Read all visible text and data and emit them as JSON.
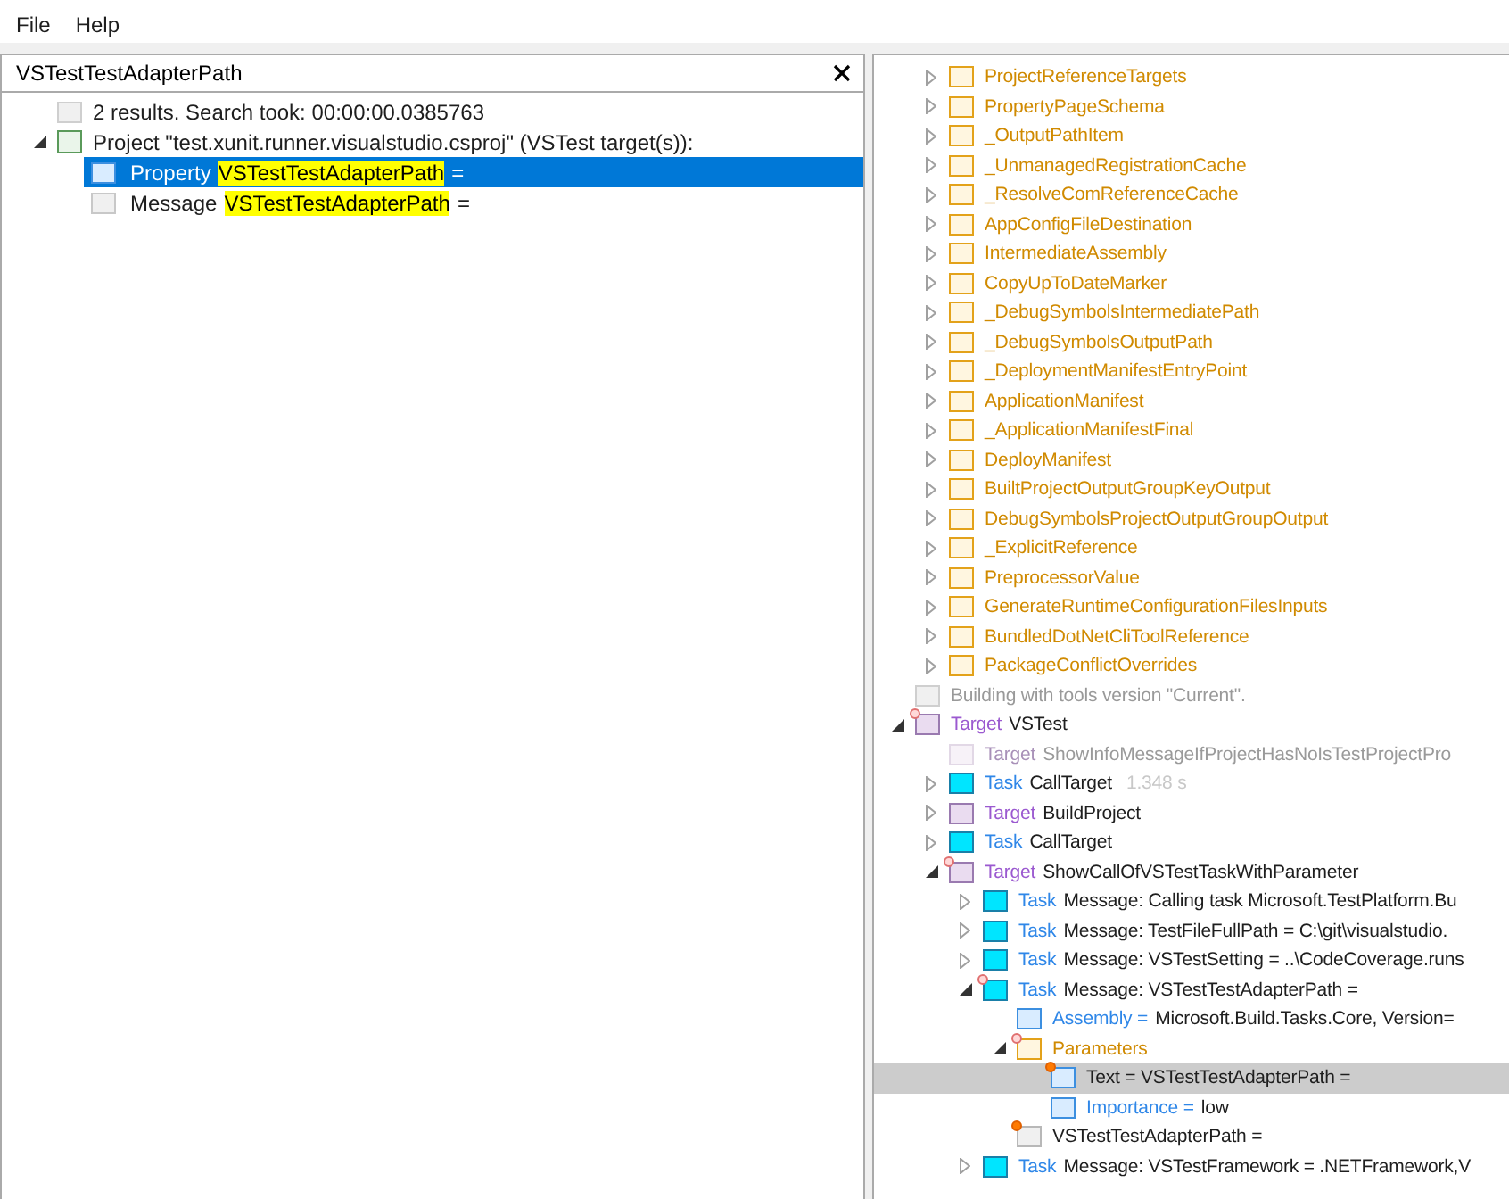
{
  "menu": [
    {
      "label": "File"
    },
    {
      "label": "Help"
    }
  ],
  "search": {
    "value": "VSTestTestAdapterPath"
  },
  "results": {
    "summary": "2 results. Search took: 00:00:00.0385763",
    "project": {
      "label": "Project \"test.xunit.runner.visualstudio.csproj\" (VSTest target(s)):",
      "expanded": true,
      "matches": [
        {
          "prefix": "Property",
          "match": "VSTestTestAdapterPath",
          "suffix": "=",
          "kind": "property",
          "selected": true
        },
        {
          "prefix": "Message",
          "match": "VSTestTestAdapterPath",
          "suffix": "=",
          "kind": "message",
          "selected": false
        }
      ]
    }
  },
  "tree": {
    "continued_items": [
      {
        "kind": "folder",
        "text": "ProjectReferenceTargets",
        "expanded": false,
        "selected": false
      },
      {
        "kind": "folder",
        "text": "PropertyPageSchema",
        "expanded": false,
        "selected": false
      },
      {
        "kind": "folder",
        "text": "_OutputPathItem",
        "expanded": false,
        "selected": false
      },
      {
        "kind": "folder",
        "text": "_UnmanagedRegistrationCache",
        "expanded": false,
        "selected": false
      },
      {
        "kind": "folder",
        "text": "_ResolveComReferenceCache",
        "expanded": false,
        "selected": false
      },
      {
        "kind": "folder",
        "text": "AppConfigFileDestination",
        "expanded": false,
        "selected": false
      },
      {
        "kind": "folder",
        "text": "IntermediateAssembly",
        "expanded": false,
        "selected": false
      },
      {
        "kind": "folder",
        "text": "CopyUpToDateMarker",
        "expanded": false,
        "selected": false
      },
      {
        "kind": "folder",
        "text": "_DebugSymbolsIntermediatePath",
        "expanded": false,
        "selected": false
      },
      {
        "kind": "folder",
        "text": "_DebugSymbolsOutputPath",
        "expanded": false,
        "selected": false
      },
      {
        "kind": "folder",
        "text": "_DeploymentManifestEntryPoint",
        "expanded": false,
        "selected": false
      },
      {
        "kind": "folder",
        "text": "ApplicationManifest",
        "expanded": false,
        "selected": false
      },
      {
        "kind": "folder",
        "text": "_ApplicationManifestFinal",
        "expanded": false,
        "selected": false
      },
      {
        "kind": "folder",
        "text": "DeployManifest",
        "expanded": false,
        "selected": false
      },
      {
        "kind": "folder",
        "text": "BuiltProjectOutputGroupKeyOutput",
        "expanded": false,
        "selected": false
      },
      {
        "kind": "folder",
        "text": "DebugSymbolsProjectOutputGroupOutput",
        "expanded": false,
        "selected": false
      },
      {
        "kind": "folder",
        "text": "_ExplicitReference",
        "expanded": false,
        "selected": false
      },
      {
        "kind": "folder",
        "text": "PreprocessorValue",
        "expanded": false,
        "selected": false
      },
      {
        "kind": "folder",
        "text": "GenerateRuntimeConfigurationFilesInputs",
        "expanded": false,
        "selected": false
      },
      {
        "kind": "folder",
        "text": "BundledDotNetCliToolReference",
        "expanded": false,
        "selected": false
      },
      {
        "kind": "folder",
        "text": "PackageConflictOverrides",
        "expanded": false,
        "selected": false
      }
    ],
    "items": [
      {
        "kind": "note",
        "text": "Building with tools version \"Current\".",
        "selected": false
      },
      {
        "kind": "target",
        "prefix": "Target",
        "text": "VSTest",
        "expanded": true,
        "selected": false,
        "contains_match": true,
        "children": [
          {
            "kind": "skipped_target",
            "prefix": "Target",
            "text": "ShowInfoMessageIfProjectHasNoIsTestProjectPro",
            "selected": false
          },
          {
            "kind": "task",
            "prefix": "Task",
            "text": "CallTarget",
            "duration": "1.348 s",
            "expanded": false,
            "selected": false
          },
          {
            "kind": "target",
            "prefix": "Target",
            "text": "BuildProject",
            "expanded": false,
            "selected": false
          },
          {
            "kind": "task",
            "prefix": "Task",
            "text": "CallTarget",
            "expanded": false,
            "selected": false
          },
          {
            "kind": "target",
            "prefix": "Target",
            "text": "ShowCallOfVSTestTaskWithParameter",
            "expanded": true,
            "selected": false,
            "contains_match": true,
            "children": [
              {
                "kind": "task",
                "prefix": "Task",
                "text": "Message: Calling task Microsoft.TestPlatform.Bu",
                "expanded": false,
                "selected": false
              },
              {
                "kind": "task",
                "prefix": "Task",
                "text": "Message: TestFileFullPath = C:\\git\\visualstudio.",
                "expanded": false,
                "selected": false
              },
              {
                "kind": "task",
                "prefix": "Task",
                "text": "Message: VSTestSetting = ..\\CodeCoverage.runs",
                "expanded": false,
                "selected": false
              },
              {
                "kind": "task",
                "prefix": "Task",
                "text": "Message: VSTestTestAdapterPath =",
                "expanded": true,
                "selected": false,
                "contains_match": true,
                "children": [
                  {
                    "kind": "property",
                    "prefix": "Assembly =",
                    "text": "Microsoft.Build.Tasks.Core, Version=",
                    "selected": false
                  },
                  {
                    "kind": "parameters",
                    "text": "Parameters",
                    "expanded": true,
                    "selected": false,
                    "contains_match": true,
                    "children": [
                      {
                        "kind": "parameter",
                        "text": "Text = VSTestTestAdapterPath =",
                        "selected": true,
                        "is_match": true
                      },
                      {
                        "kind": "property",
                        "prefix": "Importance =",
                        "text": "low",
                        "selected": false
                      }
                    ]
                  },
                  {
                    "kind": "item",
                    "text": "VSTestTestAdapterPath =",
                    "selected": false,
                    "is_match": true
                  }
                ]
              },
              {
                "kind": "task",
                "prefix": "Task",
                "text": "Message: VSTestFramework = .NETFramework,V",
                "expanded": false,
                "selected": false
              }
            ]
          }
        ]
      }
    ]
  }
}
